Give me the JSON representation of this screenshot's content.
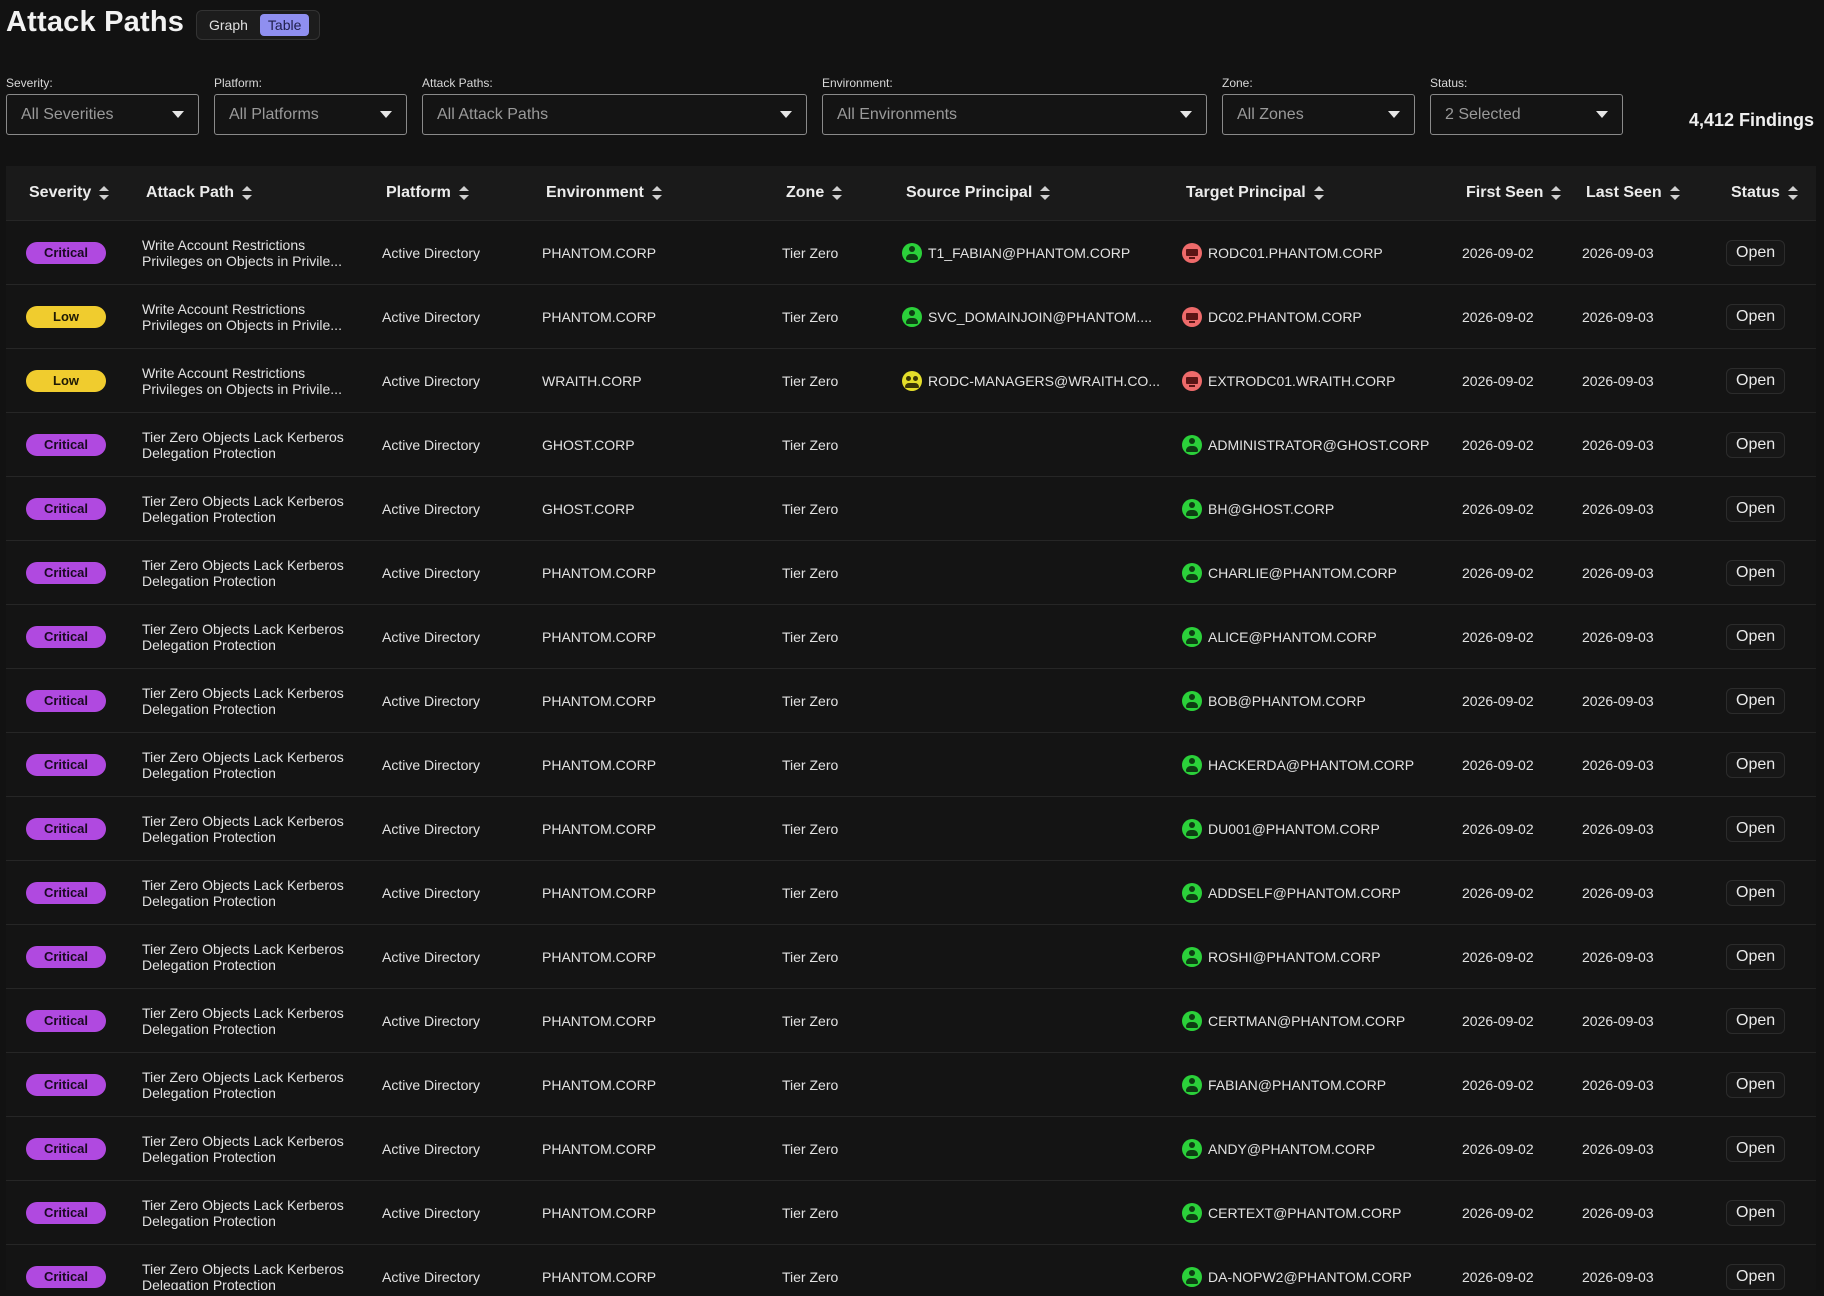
{
  "page": {
    "title": "Attack Paths"
  },
  "view_toggle": {
    "graph": "Graph",
    "table": "Table",
    "selected": "Table"
  },
  "filters": [
    {
      "label": "Severity:",
      "value": "All Severities"
    },
    {
      "label": "Platform:",
      "value": "All Platforms"
    },
    {
      "label": "Attack Paths:",
      "value": "All Attack Paths"
    },
    {
      "label": "Environment:",
      "value": "All Environments"
    },
    {
      "label": "Zone:",
      "value": "All Zones"
    },
    {
      "label": "Status:",
      "value": "2 Selected"
    }
  ],
  "findings_count": "4,412 Findings",
  "columns": [
    "Severity",
    "Attack Path",
    "Platform",
    "Environment",
    "Zone",
    "Source Principal",
    "Target Principal",
    "First Seen",
    "Last Seen",
    "Status"
  ],
  "colors": {
    "critical": "#b049e0",
    "low": "#f0cc2e",
    "user_icon": "#2bd13a",
    "group_icon": "#e4de2a",
    "computer_icon": "#ee6a6a",
    "toggle_active": "#8f8ff0"
  },
  "rows": [
    {
      "severity": "Critical",
      "path1": "Write Account Restrictions",
      "path2": "Privileges on Objects in Privile...",
      "platform": "Active Directory",
      "environment": "PHANTOM.CORP",
      "zone": "Tier Zero",
      "source": "T1_FABIAN@PHANTOM.CORP",
      "source_icon": "user",
      "target": "RODC01.PHANTOM.CORP",
      "target_icon": "computer",
      "first_seen": "2026-09-02",
      "last_seen": "2026-09-03",
      "status": "Open"
    },
    {
      "severity": "Low",
      "path1": "Write Account Restrictions",
      "path2": "Privileges on Objects in Privile...",
      "platform": "Active Directory",
      "environment": "PHANTOM.CORP",
      "zone": "Tier Zero",
      "source": "SVC_DOMAINJOIN@PHANTOM....",
      "source_icon": "user",
      "target": "DC02.PHANTOM.CORP",
      "target_icon": "computer",
      "first_seen": "2026-09-02",
      "last_seen": "2026-09-03",
      "status": "Open"
    },
    {
      "severity": "Low",
      "path1": "Write Account Restrictions",
      "path2": "Privileges on Objects in Privile...",
      "platform": "Active Directory",
      "environment": "WRAITH.CORP",
      "zone": "Tier Zero",
      "source": "RODC-MANAGERS@WRAITH.CO...",
      "source_icon": "group",
      "target": "EXTRODC01.WRAITH.CORP",
      "target_icon": "computer",
      "first_seen": "2026-09-02",
      "last_seen": "2026-09-03",
      "status": "Open"
    },
    {
      "severity": "Critical",
      "path1": "Tier Zero Objects Lack Kerberos",
      "path2": "Delegation Protection",
      "platform": "Active Directory",
      "environment": "GHOST.CORP",
      "zone": "Tier Zero",
      "source": "",
      "source_icon": "",
      "target": "ADMINISTRATOR@GHOST.CORP",
      "target_icon": "user",
      "first_seen": "2026-09-02",
      "last_seen": "2026-09-03",
      "status": "Open"
    },
    {
      "severity": "Critical",
      "path1": "Tier Zero Objects Lack Kerberos",
      "path2": "Delegation Protection",
      "platform": "Active Directory",
      "environment": "GHOST.CORP",
      "zone": "Tier Zero",
      "source": "",
      "source_icon": "",
      "target": "BH@GHOST.CORP",
      "target_icon": "user",
      "first_seen": "2026-09-02",
      "last_seen": "2026-09-03",
      "status": "Open"
    },
    {
      "severity": "Critical",
      "path1": "Tier Zero Objects Lack Kerberos",
      "path2": "Delegation Protection",
      "platform": "Active Directory",
      "environment": "PHANTOM.CORP",
      "zone": "Tier Zero",
      "source": "",
      "source_icon": "",
      "target": "CHARLIE@PHANTOM.CORP",
      "target_icon": "user",
      "first_seen": "2026-09-02",
      "last_seen": "2026-09-03",
      "status": "Open"
    },
    {
      "severity": "Critical",
      "path1": "Tier Zero Objects Lack Kerberos",
      "path2": "Delegation Protection",
      "platform": "Active Directory",
      "environment": "PHANTOM.CORP",
      "zone": "Tier Zero",
      "source": "",
      "source_icon": "",
      "target": "ALICE@PHANTOM.CORP",
      "target_icon": "user",
      "first_seen": "2026-09-02",
      "last_seen": "2026-09-03",
      "status": "Open"
    },
    {
      "severity": "Critical",
      "path1": "Tier Zero Objects Lack Kerberos",
      "path2": "Delegation Protection",
      "platform": "Active Directory",
      "environment": "PHANTOM.CORP",
      "zone": "Tier Zero",
      "source": "",
      "source_icon": "",
      "target": "BOB@PHANTOM.CORP",
      "target_icon": "user",
      "first_seen": "2026-09-02",
      "last_seen": "2026-09-03",
      "status": "Open"
    },
    {
      "severity": "Critical",
      "path1": "Tier Zero Objects Lack Kerberos",
      "path2": "Delegation Protection",
      "platform": "Active Directory",
      "environment": "PHANTOM.CORP",
      "zone": "Tier Zero",
      "source": "",
      "source_icon": "",
      "target": "HACKERDA@PHANTOM.CORP",
      "target_icon": "user",
      "first_seen": "2026-09-02",
      "last_seen": "2026-09-03",
      "status": "Open"
    },
    {
      "severity": "Critical",
      "path1": "Tier Zero Objects Lack Kerberos",
      "path2": "Delegation Protection",
      "platform": "Active Directory",
      "environment": "PHANTOM.CORP",
      "zone": "Tier Zero",
      "source": "",
      "source_icon": "",
      "target": "DU001@PHANTOM.CORP",
      "target_icon": "user",
      "first_seen": "2026-09-02",
      "last_seen": "2026-09-03",
      "status": "Open"
    },
    {
      "severity": "Critical",
      "path1": "Tier Zero Objects Lack Kerberos",
      "path2": "Delegation Protection",
      "platform": "Active Directory",
      "environment": "PHANTOM.CORP",
      "zone": "Tier Zero",
      "source": "",
      "source_icon": "",
      "target": "ADDSELF@PHANTOM.CORP",
      "target_icon": "user",
      "first_seen": "2026-09-02",
      "last_seen": "2026-09-03",
      "status": "Open"
    },
    {
      "severity": "Critical",
      "path1": "Tier Zero Objects Lack Kerberos",
      "path2": "Delegation Protection",
      "platform": "Active Directory",
      "environment": "PHANTOM.CORP",
      "zone": "Tier Zero",
      "source": "",
      "source_icon": "",
      "target": "ROSHI@PHANTOM.CORP",
      "target_icon": "user",
      "first_seen": "2026-09-02",
      "last_seen": "2026-09-03",
      "status": "Open"
    },
    {
      "severity": "Critical",
      "path1": "Tier Zero Objects Lack Kerberos",
      "path2": "Delegation Protection",
      "platform": "Active Directory",
      "environment": "PHANTOM.CORP",
      "zone": "Tier Zero",
      "source": "",
      "source_icon": "",
      "target": "CERTMAN@PHANTOM.CORP",
      "target_icon": "user",
      "first_seen": "2026-09-02",
      "last_seen": "2026-09-03",
      "status": "Open"
    },
    {
      "severity": "Critical",
      "path1": "Tier Zero Objects Lack Kerberos",
      "path2": "Delegation Protection",
      "platform": "Active Directory",
      "environment": "PHANTOM.CORP",
      "zone": "Tier Zero",
      "source": "",
      "source_icon": "",
      "target": "FABIAN@PHANTOM.CORP",
      "target_icon": "user",
      "first_seen": "2026-09-02",
      "last_seen": "2026-09-03",
      "status": "Open"
    },
    {
      "severity": "Critical",
      "path1": "Tier Zero Objects Lack Kerberos",
      "path2": "Delegation Protection",
      "platform": "Active Directory",
      "environment": "PHANTOM.CORP",
      "zone": "Tier Zero",
      "source": "",
      "source_icon": "",
      "target": "ANDY@PHANTOM.CORP",
      "target_icon": "user",
      "first_seen": "2026-09-02",
      "last_seen": "2026-09-03",
      "status": "Open"
    },
    {
      "severity": "Critical",
      "path1": "Tier Zero Objects Lack Kerberos",
      "path2": "Delegation Protection",
      "platform": "Active Directory",
      "environment": "PHANTOM.CORP",
      "zone": "Tier Zero",
      "source": "",
      "source_icon": "",
      "target": "CERTEXT@PHANTOM.CORP",
      "target_icon": "user",
      "first_seen": "2026-09-02",
      "last_seen": "2026-09-03",
      "status": "Open"
    },
    {
      "severity": "Critical",
      "path1": "Tier Zero Objects Lack Kerberos",
      "path2": "Delegation Protection",
      "platform": "Active Directory",
      "environment": "PHANTOM.CORP",
      "zone": "Tier Zero",
      "source": "",
      "source_icon": "",
      "target": "DA-NOPW2@PHANTOM.CORP",
      "target_icon": "user",
      "first_seen": "2026-09-02",
      "last_seen": "2026-09-03",
      "status": "Open"
    }
  ]
}
